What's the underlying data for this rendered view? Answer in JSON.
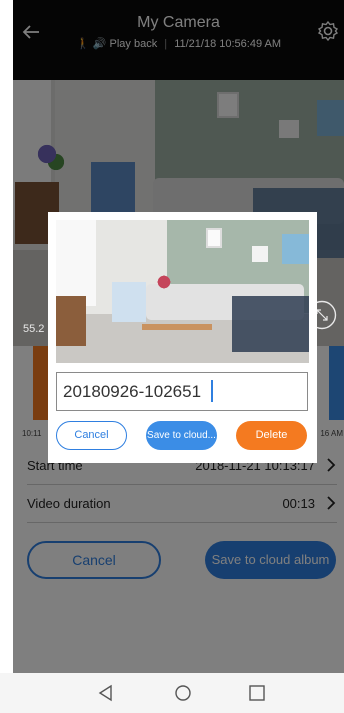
{
  "header": {
    "title": "My Camera",
    "playback_label": "Play back",
    "timestamp": "11/21/18 10:56:49 AM"
  },
  "video": {
    "overlay_time_fragment": "55.2"
  },
  "timeline": {
    "start_label": "10:11",
    "end_label": "16 AM"
  },
  "details": {
    "start_time_label": "Start time",
    "start_time_value": "2018-11-21 10:13:17",
    "duration_label": "Video duration",
    "duration_value": "00:13"
  },
  "actions": {
    "cancel_label": "Cancel",
    "save_album_label": "Save to cloud album"
  },
  "dialog": {
    "filename_value": "20180926-102651",
    "cancel_label": "Cancel",
    "save_label": "Save to cloud...",
    "delete_label": "Delete"
  },
  "colors": {
    "accent_blue": "#2f7fe0",
    "accent_orange": "#f47a20",
    "header_bg": "#0a0a0a"
  },
  "icons": [
    "back-arrow-icon",
    "walking-person-icon",
    "speaker-icon",
    "gear-icon",
    "expand-icon",
    "chevron-right-icon",
    "nav-back-icon",
    "nav-home-icon",
    "nav-recent-icon"
  ]
}
